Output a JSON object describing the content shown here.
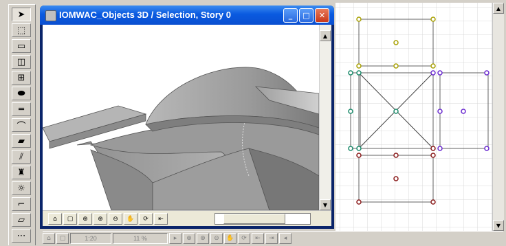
{
  "window": {
    "title": "IOMWAC_Objects 3D / Selection, Story 0",
    "controls": {
      "minimize": "_",
      "maximize": "□",
      "close": "✕"
    }
  },
  "toolbox": {
    "tools": [
      {
        "name": "arrow-tool-icon",
        "glyph": "➤",
        "active": true
      },
      {
        "name": "marquee-tool-icon",
        "glyph": "⬚",
        "active": false
      },
      {
        "name": "wall-tool-icon",
        "glyph": "▭",
        "active": false
      },
      {
        "name": "door-tool-icon",
        "glyph": "◫",
        "active": false
      },
      {
        "name": "window-tool-icon",
        "glyph": "⊞",
        "active": false
      },
      {
        "name": "object-tool-icon",
        "glyph": "⬬",
        "active": false
      },
      {
        "name": "beam-tool-icon",
        "glyph": "═",
        "active": false
      },
      {
        "name": "roof-tool-icon",
        "glyph": "⌒",
        "active": false
      },
      {
        "name": "slab-tool-icon",
        "glyph": "▰",
        "active": false
      },
      {
        "name": "mesh-tool-icon",
        "glyph": "⫽",
        "active": false
      },
      {
        "name": "chair-tool-icon",
        "glyph": "♜",
        "active": false
      },
      {
        "name": "lamp-tool-icon",
        "glyph": "☼",
        "active": false
      },
      {
        "name": "stair-tool-icon",
        "glyph": "⌐",
        "active": false
      },
      {
        "name": "zone-tool-icon",
        "glyph": "▱",
        "active": false
      },
      {
        "name": "dimension-tool-icon",
        "glyph": "⋯",
        "active": false
      }
    ]
  },
  "nav3d": {
    "buttons": [
      "⌂",
      "▢",
      "⊕",
      "⊕",
      "⊖",
      "✋",
      "⟳",
      "⇤"
    ]
  },
  "statusbar": {
    "scale": "1:20",
    "zoom": "11 %"
  },
  "colors": {
    "title_gradient_top": "#3b8cf0",
    "title_gradient_bottom": "#0a4fd0",
    "roof_light": "#c0c0c0",
    "roof_dark": "#8a8a8a",
    "hotspot_olive": "#a8a000",
    "hotspot_green": "#1a8a6a",
    "hotspot_purple": "#6a2ad0",
    "hotspot_red": "#8a1a1a"
  }
}
